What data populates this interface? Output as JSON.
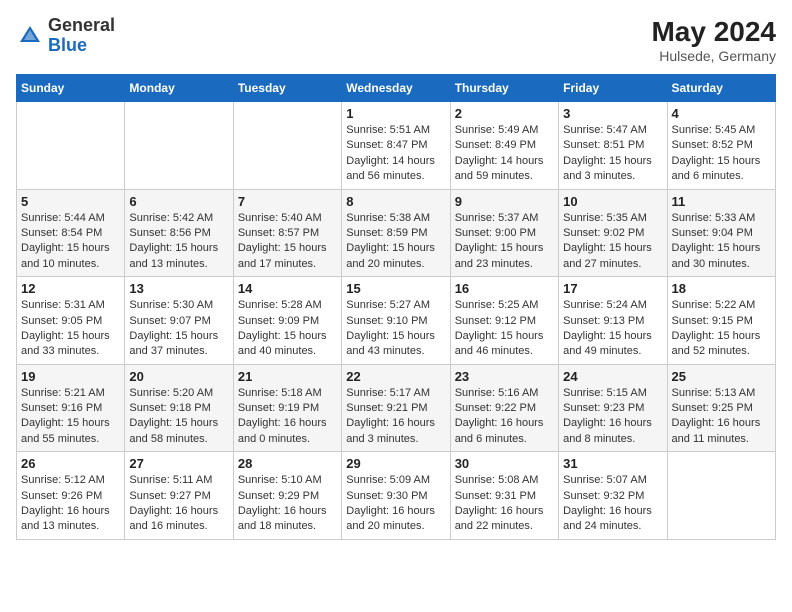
{
  "header": {
    "logo_general": "General",
    "logo_blue": "Blue",
    "month_year": "May 2024",
    "location": "Hulsede, Germany"
  },
  "days_of_week": [
    "Sunday",
    "Monday",
    "Tuesday",
    "Wednesday",
    "Thursday",
    "Friday",
    "Saturday"
  ],
  "weeks": [
    [
      {
        "day": "",
        "info": ""
      },
      {
        "day": "",
        "info": ""
      },
      {
        "day": "",
        "info": ""
      },
      {
        "day": "1",
        "info": "Sunrise: 5:51 AM\nSunset: 8:47 PM\nDaylight: 14 hours\nand 56 minutes."
      },
      {
        "day": "2",
        "info": "Sunrise: 5:49 AM\nSunset: 8:49 PM\nDaylight: 14 hours\nand 59 minutes."
      },
      {
        "day": "3",
        "info": "Sunrise: 5:47 AM\nSunset: 8:51 PM\nDaylight: 15 hours\nand 3 minutes."
      },
      {
        "day": "4",
        "info": "Sunrise: 5:45 AM\nSunset: 8:52 PM\nDaylight: 15 hours\nand 6 minutes."
      }
    ],
    [
      {
        "day": "5",
        "info": "Sunrise: 5:44 AM\nSunset: 8:54 PM\nDaylight: 15 hours\nand 10 minutes."
      },
      {
        "day": "6",
        "info": "Sunrise: 5:42 AM\nSunset: 8:56 PM\nDaylight: 15 hours\nand 13 minutes."
      },
      {
        "day": "7",
        "info": "Sunrise: 5:40 AM\nSunset: 8:57 PM\nDaylight: 15 hours\nand 17 minutes."
      },
      {
        "day": "8",
        "info": "Sunrise: 5:38 AM\nSunset: 8:59 PM\nDaylight: 15 hours\nand 20 minutes."
      },
      {
        "day": "9",
        "info": "Sunrise: 5:37 AM\nSunset: 9:00 PM\nDaylight: 15 hours\nand 23 minutes."
      },
      {
        "day": "10",
        "info": "Sunrise: 5:35 AM\nSunset: 9:02 PM\nDaylight: 15 hours\nand 27 minutes."
      },
      {
        "day": "11",
        "info": "Sunrise: 5:33 AM\nSunset: 9:04 PM\nDaylight: 15 hours\nand 30 minutes."
      }
    ],
    [
      {
        "day": "12",
        "info": "Sunrise: 5:31 AM\nSunset: 9:05 PM\nDaylight: 15 hours\nand 33 minutes."
      },
      {
        "day": "13",
        "info": "Sunrise: 5:30 AM\nSunset: 9:07 PM\nDaylight: 15 hours\nand 37 minutes."
      },
      {
        "day": "14",
        "info": "Sunrise: 5:28 AM\nSunset: 9:09 PM\nDaylight: 15 hours\nand 40 minutes."
      },
      {
        "day": "15",
        "info": "Sunrise: 5:27 AM\nSunset: 9:10 PM\nDaylight: 15 hours\nand 43 minutes."
      },
      {
        "day": "16",
        "info": "Sunrise: 5:25 AM\nSunset: 9:12 PM\nDaylight: 15 hours\nand 46 minutes."
      },
      {
        "day": "17",
        "info": "Sunrise: 5:24 AM\nSunset: 9:13 PM\nDaylight: 15 hours\nand 49 minutes."
      },
      {
        "day": "18",
        "info": "Sunrise: 5:22 AM\nSunset: 9:15 PM\nDaylight: 15 hours\nand 52 minutes."
      }
    ],
    [
      {
        "day": "19",
        "info": "Sunrise: 5:21 AM\nSunset: 9:16 PM\nDaylight: 15 hours\nand 55 minutes."
      },
      {
        "day": "20",
        "info": "Sunrise: 5:20 AM\nSunset: 9:18 PM\nDaylight: 15 hours\nand 58 minutes."
      },
      {
        "day": "21",
        "info": "Sunrise: 5:18 AM\nSunset: 9:19 PM\nDaylight: 16 hours\nand 0 minutes."
      },
      {
        "day": "22",
        "info": "Sunrise: 5:17 AM\nSunset: 9:21 PM\nDaylight: 16 hours\nand 3 minutes."
      },
      {
        "day": "23",
        "info": "Sunrise: 5:16 AM\nSunset: 9:22 PM\nDaylight: 16 hours\nand 6 minutes."
      },
      {
        "day": "24",
        "info": "Sunrise: 5:15 AM\nSunset: 9:23 PM\nDaylight: 16 hours\nand 8 minutes."
      },
      {
        "day": "25",
        "info": "Sunrise: 5:13 AM\nSunset: 9:25 PM\nDaylight: 16 hours\nand 11 minutes."
      }
    ],
    [
      {
        "day": "26",
        "info": "Sunrise: 5:12 AM\nSunset: 9:26 PM\nDaylight: 16 hours\nand 13 minutes."
      },
      {
        "day": "27",
        "info": "Sunrise: 5:11 AM\nSunset: 9:27 PM\nDaylight: 16 hours\nand 16 minutes."
      },
      {
        "day": "28",
        "info": "Sunrise: 5:10 AM\nSunset: 9:29 PM\nDaylight: 16 hours\nand 18 minutes."
      },
      {
        "day": "29",
        "info": "Sunrise: 5:09 AM\nSunset: 9:30 PM\nDaylight: 16 hours\nand 20 minutes."
      },
      {
        "day": "30",
        "info": "Sunrise: 5:08 AM\nSunset: 9:31 PM\nDaylight: 16 hours\nand 22 minutes."
      },
      {
        "day": "31",
        "info": "Sunrise: 5:07 AM\nSunset: 9:32 PM\nDaylight: 16 hours\nand 24 minutes."
      },
      {
        "day": "",
        "info": ""
      }
    ]
  ]
}
